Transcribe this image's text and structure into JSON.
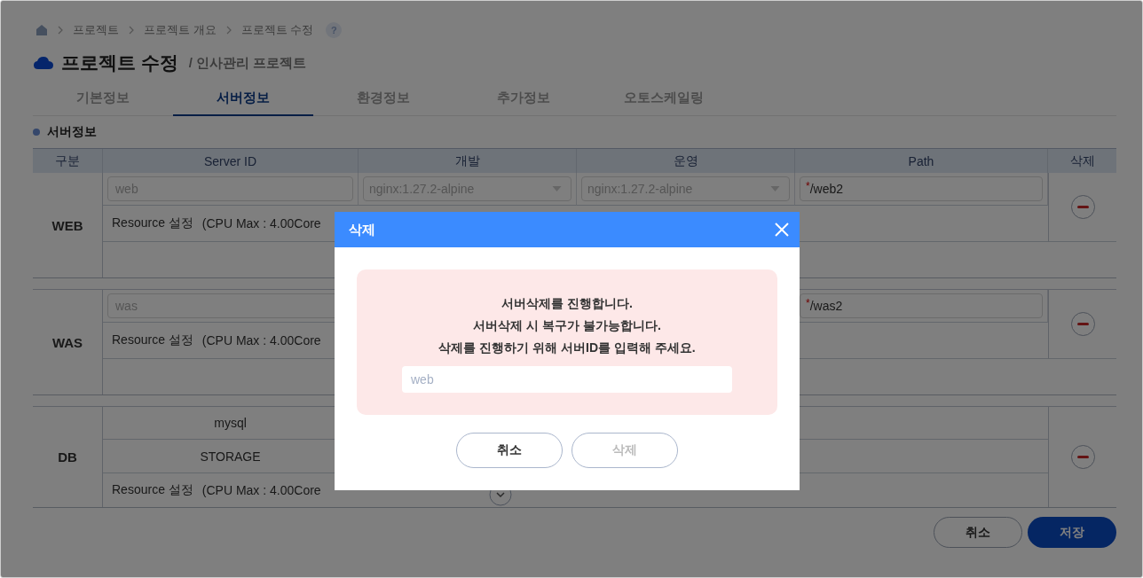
{
  "breadcrumb": {
    "items": [
      "프로젝트",
      "프로젝트 개요",
      "프로젝트 수정"
    ],
    "help": "?"
  },
  "header": {
    "title": "프로젝트 수정",
    "subtitle": "/ 인사관리 프로젝트"
  },
  "tabs": [
    {
      "label": "기본정보",
      "selected": false
    },
    {
      "label": "서버정보",
      "selected": true
    },
    {
      "label": "환경정보",
      "selected": false
    },
    {
      "label": "추가정보",
      "selected": false
    },
    {
      "label": "오토스케일링",
      "selected": false
    }
  ],
  "section_title": "서버정보",
  "table": {
    "columns": [
      "구분",
      "Server ID",
      "개발",
      "운영",
      "Path",
      "삭제"
    ],
    "groups": [
      {
        "kind": "app",
        "name": "WEB",
        "server_id": {
          "value": "web",
          "disabled": true
        },
        "dev": {
          "value": "nginx:1.27.2-alpine",
          "disabled": true
        },
        "ops": {
          "value": "nginx:1.27.2-alpine",
          "disabled": true
        },
        "path": {
          "value": "/web2",
          "required_mark": "*"
        },
        "resource_label": "Resource 설정",
        "resource_detail": "(CPU Max : 4.00Core"
      },
      {
        "kind": "app",
        "name": "WAS",
        "server_id": {
          "value": "was",
          "disabled": true
        },
        "path": {
          "value": "/was2",
          "required_mark": "*"
        },
        "resource_label": "Resource 설정",
        "resource_detail": "(CPU Max : 4.00Core"
      },
      {
        "kind": "db",
        "name": "DB",
        "items": [
          "mysql",
          "STORAGE"
        ],
        "resource_label": "Resource 설정",
        "resource_detail": "(CPU Max : 4.00Core"
      }
    ]
  },
  "footer_buttons": [
    {
      "label": "취소",
      "kind": "secondary"
    },
    {
      "label": "저장",
      "kind": "primary"
    }
  ],
  "dialog": {
    "title": "삭제",
    "messages": [
      "서버삭제를 진행합니다.",
      "서버삭제 시 복구가 불가능합니다.",
      "삭제를 진행하기 위해 서버ID를 입력해 주세요."
    ],
    "input": {
      "placeholder": "web"
    },
    "buttons": [
      {
        "label": "취소",
        "disabled": false
      },
      {
        "label": "삭제",
        "disabled": true
      }
    ]
  }
}
